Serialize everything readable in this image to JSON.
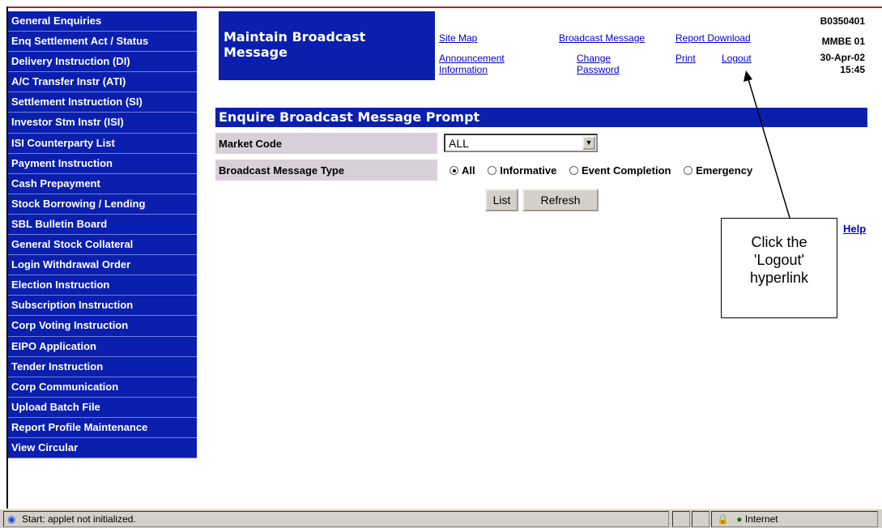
{
  "sidebar": {
    "items": [
      {
        "label": "General Enquiries"
      },
      {
        "label": "Enq Settlement Act / Status"
      },
      {
        "label": "Delivery Instruction (DI)"
      },
      {
        "label": "A/C Transfer Instr (ATI)"
      },
      {
        "label": "Settlement Instruction (SI)"
      },
      {
        "label": "Investor Stm Instr (ISI)"
      },
      {
        "label": "ISI Counterparty List"
      },
      {
        "label": "Payment Instruction"
      },
      {
        "label": "Cash Prepayment"
      },
      {
        "label": "Stock Borrowing / Lending"
      },
      {
        "label": "SBL Bulletin Board"
      },
      {
        "label": "General Stock Collateral"
      },
      {
        "label": "Login Withdrawal Order"
      },
      {
        "label": "Election Instruction"
      },
      {
        "label": "Subscription Instruction"
      },
      {
        "label": "Corp Voting Instruction"
      },
      {
        "label": "EIPO Application"
      },
      {
        "label": "Tender Instruction"
      },
      {
        "label": "Corp Communication"
      },
      {
        "label": "Upload Batch File"
      },
      {
        "label": "Report Profile Maintenance"
      },
      {
        "label": "View Circular"
      }
    ]
  },
  "header": {
    "title": "Maintain Broadcast Message",
    "links": {
      "site_map": "Site Map",
      "broadcast_message": "Broadcast Message",
      "report_download": "Report Download",
      "announcement_line1": "Announcement",
      "announcement_line2": "Information",
      "change_line1": "Change",
      "change_line2": "Password",
      "print": "Print",
      "logout": "Logout"
    },
    "system_id": "B0350401",
    "user_id": "MMBE 01",
    "date": "30-Apr-02",
    "time": "15:45"
  },
  "form": {
    "title": "Enquire Broadcast Message Prompt",
    "market_code_label": "Market Code",
    "market_code_value": "ALL",
    "message_type_label": "Broadcast Message Type",
    "message_type_options": [
      "All",
      "Informative",
      "Event Completion",
      "Emergency"
    ],
    "message_type_selected": "All",
    "list_button": "List",
    "refresh_button": "Refresh",
    "help_link": "Help"
  },
  "annotation": {
    "line1": "Click the",
    "line2": "'Logout'",
    "line3": "hyperlink"
  },
  "statusbar": {
    "message": "Start: applet not initialized.",
    "zone": "Internet"
  }
}
